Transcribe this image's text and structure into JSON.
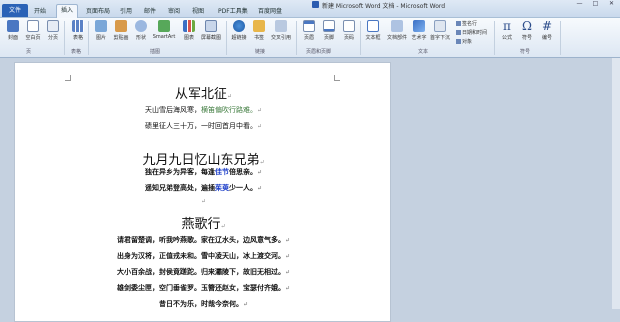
{
  "window": {
    "title": "新建 Microsoft Word 文档 - Microsoft Word",
    "controls": [
      "—",
      "□",
      "✕"
    ]
  },
  "tabs": {
    "file": "文件",
    "items": [
      "开始",
      "插入",
      "页面布局",
      "引用",
      "邮件",
      "审阅",
      "视图",
      "PDF工具集",
      "百度网盘"
    ],
    "active_index": 1
  },
  "ribbon": {
    "buttons": {
      "cover": "封面",
      "blank_page": "空白页",
      "page_break": "分页",
      "table": "表格",
      "picture": "图片",
      "clipart": "剪贴画",
      "shapes": "形状",
      "smartart": "SmartArt",
      "chart": "图表",
      "screenshot": "屏幕截图",
      "hyperlink": "超链接",
      "bookmark": "书签",
      "cross_ref": "交叉引用",
      "header": "页眉",
      "footer": "页脚",
      "page_number": "页码",
      "textbox": "文本框",
      "quick_parts": "文档部件",
      "wordart": "艺术字",
      "dropcap": "首字下沉",
      "equation": "公式",
      "symbol": "符号",
      "number": "编号"
    },
    "small": {
      "signature": "签名行",
      "datetime": "日期和时间",
      "object": "对象"
    },
    "glyphs": {
      "equation": "π",
      "symbol": "Ω",
      "number": "#"
    },
    "groups": {
      "pages": "页",
      "tables": "表格",
      "illustrations": "插图",
      "links": "链接",
      "header_footer": "页眉和页脚",
      "text": "文本",
      "symbols": "符号"
    }
  },
  "document": {
    "paragraph_mark": "↵",
    "poem1": {
      "title": "从军北征",
      "lines": [
        {
          "a": "天山雪后海风寒，",
          "b": "横笛偏吹行路难。"
        },
        {
          "a": "碛里征人三十万，",
          "b": "一时回首月中看。"
        }
      ]
    },
    "poem2": {
      "title": "九月九日忆山东兄弟",
      "line1": {
        "a": "独在异乡为异客，每逢",
        "b": "佳节",
        "c": "倍思亲。"
      },
      "line2": {
        "a": "遥知兄弟登高处，遍插",
        "b": "茱萸",
        "c": "少一人。"
      }
    },
    "poem3": {
      "title": "燕歌行",
      "lines": [
        "请君留楚调，听我吟燕歌。家在辽水头，边风意气多。",
        "出身为汉将，正值戎未和。雪中凌天山，冰上渡交河。",
        "大小百余战，封侯竟蹉跎。归来灞陵下，故旧无相过。",
        "雄剑委尘匣，空门垂雀罗。玉簪还赵女，宝瑟付齐娥。",
        "昔日不为乐，时哉今奈何。"
      ]
    }
  }
}
